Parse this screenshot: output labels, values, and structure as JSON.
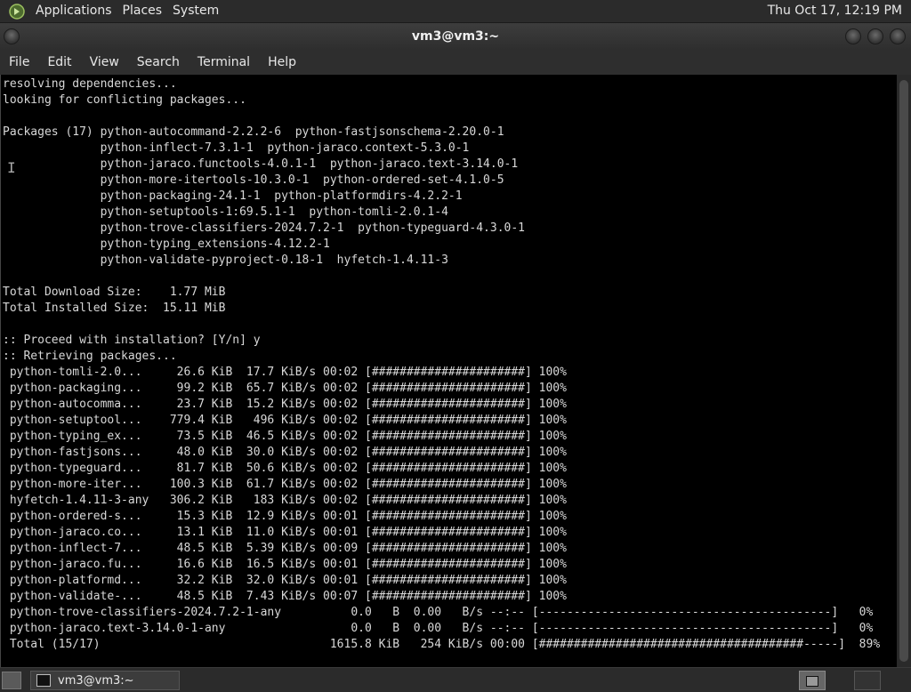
{
  "top_panel": {
    "menus": [
      "Applications",
      "Places",
      "System"
    ],
    "clock": "Thu Oct 17, 12:19 PM"
  },
  "window": {
    "title": "vm3@vm3:~",
    "menu": [
      "File",
      "Edit",
      "View",
      "Search",
      "Terminal",
      "Help"
    ]
  },
  "terminal": {
    "lines": [
      "resolving dependencies...",
      "looking for conflicting packages...",
      "",
      "Packages (17) python-autocommand-2.2.2-6  python-fastjsonschema-2.20.0-1",
      "              python-inflect-7.3.1-1  python-jaraco.context-5.3.0-1",
      "              python-jaraco.functools-4.0.1-1  python-jaraco.text-3.14.0-1",
      "              python-more-itertools-10.3.0-1  python-ordered-set-4.1.0-5",
      "              python-packaging-24.1-1  python-platformdirs-4.2.2-1",
      "              python-setuptools-1:69.5.1-1  python-tomli-2.0.1-4",
      "              python-trove-classifiers-2024.7.2-1  python-typeguard-4.3.0-1",
      "              python-typing_extensions-4.12.2-1",
      "              python-validate-pyproject-0.18-1  hyfetch-1.4.11-3",
      "",
      "Total Download Size:    1.77 MiB",
      "Total Installed Size:  15.11 MiB",
      "",
      ":: Proceed with installation? [Y/n] y",
      ":: Retrieving packages...",
      " python-tomli-2.0...     26.6 KiB  17.7 KiB/s 00:02 [######################] 100%",
      " python-packaging...     99.2 KiB  65.7 KiB/s 00:02 [######################] 100%",
      " python-autocomma...     23.7 KiB  15.2 KiB/s 00:02 [######################] 100%",
      " python-setuptool...    779.4 KiB   496 KiB/s 00:02 [######################] 100%",
      " python-typing_ex...     73.5 KiB  46.5 KiB/s 00:02 [######################] 100%",
      " python-fastjsons...     48.0 KiB  30.0 KiB/s 00:02 [######################] 100%",
      " python-typeguard...     81.7 KiB  50.6 KiB/s 00:02 [######################] 100%",
      " python-more-iter...    100.3 KiB  61.7 KiB/s 00:02 [######################] 100%",
      " hyfetch-1.4.11-3-any   306.2 KiB   183 KiB/s 00:02 [######################] 100%",
      " python-ordered-s...     15.3 KiB  12.9 KiB/s 00:01 [######################] 100%",
      " python-jaraco.co...     13.1 KiB  11.0 KiB/s 00:01 [######################] 100%",
      " python-inflect-7...     48.5 KiB  5.39 KiB/s 00:09 [######################] 100%",
      " python-jaraco.fu...     16.6 KiB  16.5 KiB/s 00:01 [######################] 100%",
      " python-platformd...     32.2 KiB  32.0 KiB/s 00:01 [######################] 100%",
      " python-validate-...     48.5 KiB  7.43 KiB/s 00:07 [######################] 100%",
      " python-trove-classifiers-2024.7.2-1-any          0.0   B  0.00   B/s --:-- [------------------------------------------]   0%",
      " python-jaraco.text-3.14.0-1-any                  0.0   B  0.00   B/s --:-- [------------------------------------------]   0%",
      " Total (15/17)                                 1615.8 KiB   254 KiB/s 00:00 [######################################-----]  89%"
    ]
  },
  "taskbar": {
    "task_label": "vm3@vm3:~"
  },
  "colors": {
    "panel_bg": "#2b2b2b",
    "terminal_bg": "#000000",
    "terminal_fg": "#d8d8d8"
  }
}
